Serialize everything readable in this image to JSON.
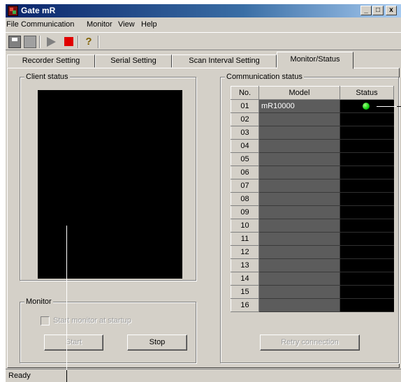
{
  "window": {
    "title": "Gate mR"
  },
  "caption_buttons": {
    "minimize": "_",
    "maximize": "□",
    "close": "x"
  },
  "menu": [
    "File",
    "Communication",
    "Monitor",
    "View",
    "Help"
  ],
  "toolbar": {
    "help_glyph": "?"
  },
  "tabs": [
    "Recorder Setting",
    "Serial Setting",
    "Scan Interval Setting",
    "Monitor/Status"
  ],
  "client_status": {
    "label": "Client status"
  },
  "monitor": {
    "label": "Monitor",
    "checkbox_label": "Start monitor at startup",
    "start_label": "Start",
    "stop_label": "Stop"
  },
  "communication": {
    "label": "Communication status",
    "headers": [
      "No.",
      "Model",
      "Status"
    ],
    "rows": [
      {
        "no": "01",
        "model": "mR10000"
      },
      {
        "no": "02",
        "model": ""
      },
      {
        "no": "03",
        "model": ""
      },
      {
        "no": "04",
        "model": ""
      },
      {
        "no": "05",
        "model": ""
      },
      {
        "no": "06",
        "model": ""
      },
      {
        "no": "07",
        "model": ""
      },
      {
        "no": "08",
        "model": ""
      },
      {
        "no": "09",
        "model": ""
      },
      {
        "no": "10",
        "model": ""
      },
      {
        "no": "11",
        "model": ""
      },
      {
        "no": "12",
        "model": ""
      },
      {
        "no": "13",
        "model": ""
      },
      {
        "no": "14",
        "model": ""
      },
      {
        "no": "15",
        "model": ""
      },
      {
        "no": "16",
        "model": ""
      }
    ],
    "retry_label": "Retry connection"
  },
  "statusbar": {
    "text": "Ready"
  }
}
